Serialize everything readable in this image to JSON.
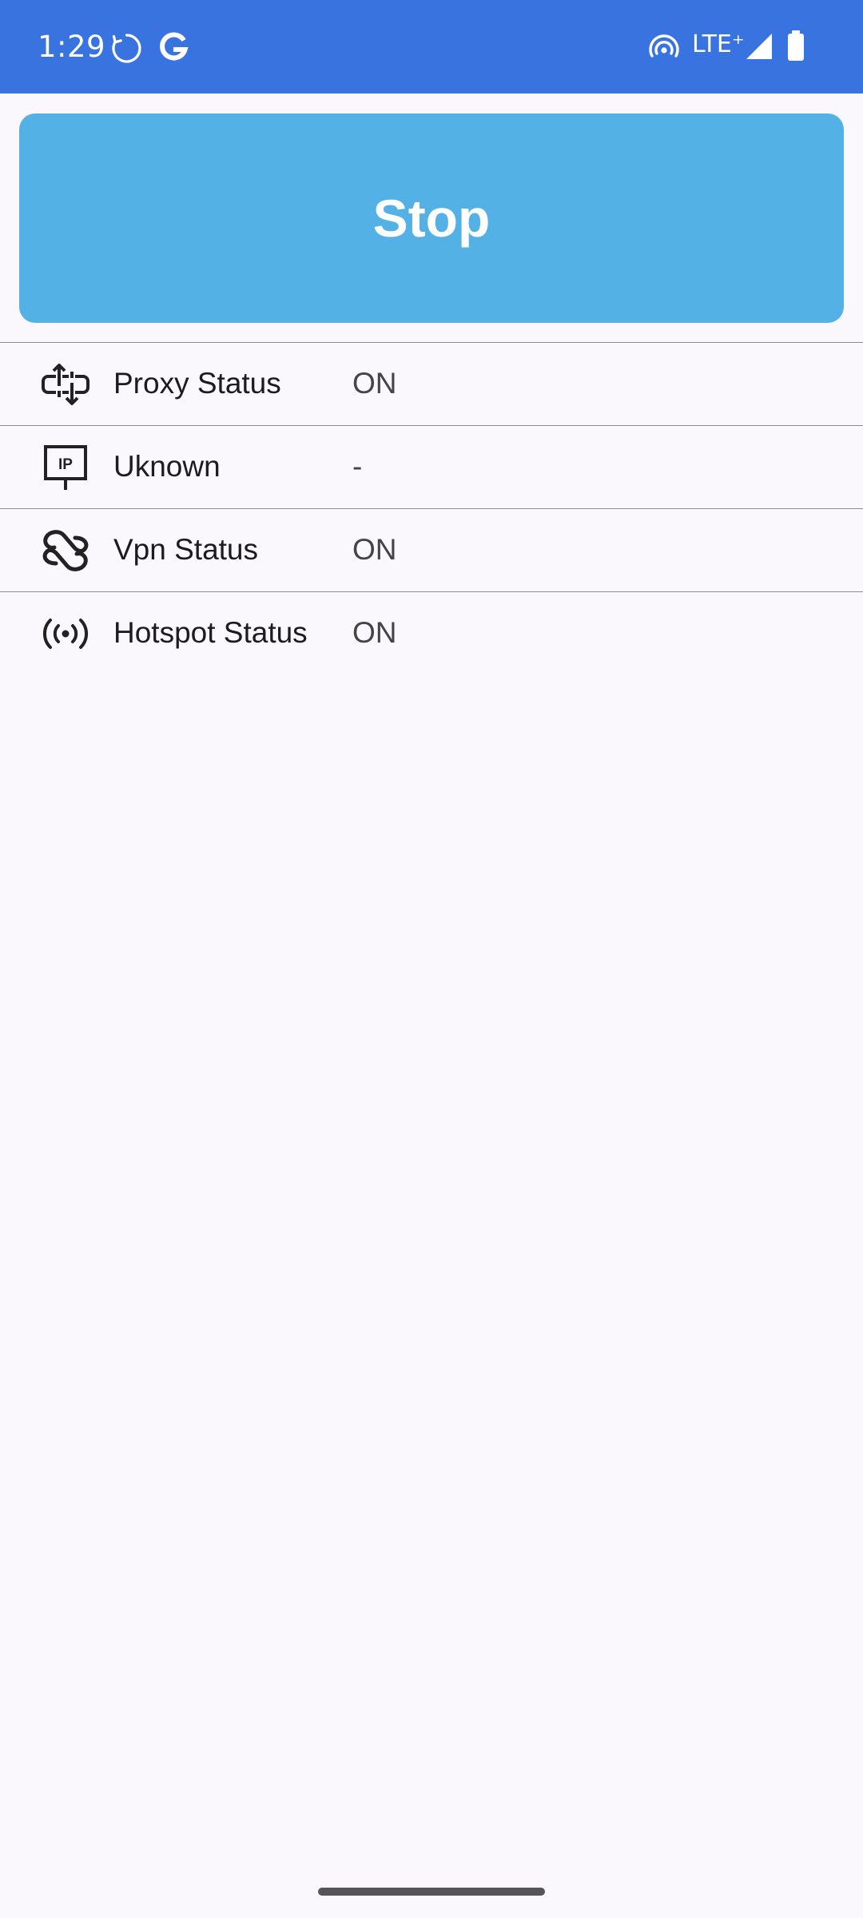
{
  "status_bar": {
    "time": "1:29",
    "network": "LTE⁺",
    "icons": [
      "sync-icon",
      "google-g-icon",
      "hotspot-icon",
      "signal-icon",
      "battery-icon"
    ],
    "background_color": "#3873E0"
  },
  "main": {
    "stop_button": {
      "label": "Stop",
      "color": "#53B1E6"
    },
    "rows": [
      {
        "icon": "proxy-icon",
        "label": "Proxy Status",
        "value": "ON"
      },
      {
        "icon": "ip-icon",
        "label": "Uknown",
        "value": "-"
      },
      {
        "icon": "vpn-icon",
        "label": "Vpn Status",
        "value": "ON"
      },
      {
        "icon": "hotspot-icon",
        "label": "Hotspot Status",
        "value": "ON"
      }
    ]
  }
}
